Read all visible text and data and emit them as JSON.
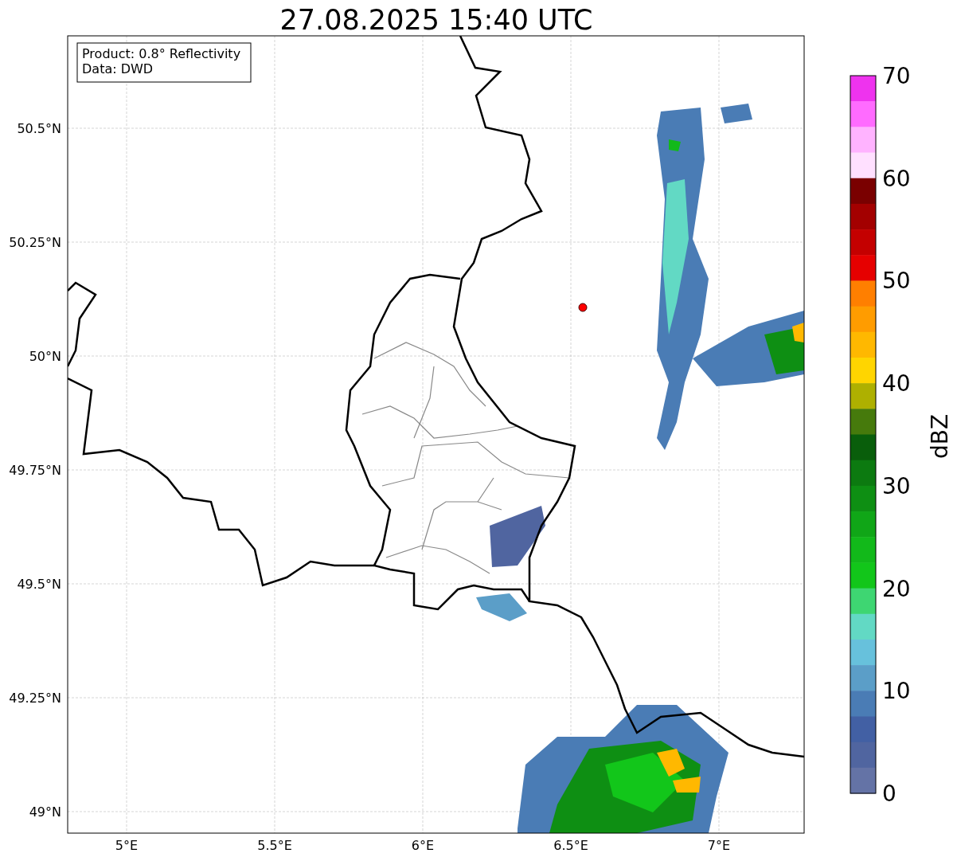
{
  "title": "27.08.2025 15:40 UTC",
  "info_box": [
    "Product: 0.8° Reflectivity",
    "Data: DWD"
  ],
  "y_ticks": [
    "50.5°N",
    "50.25°N",
    "50°N",
    "49.75°N",
    "49.5°N",
    "49.25°N",
    "49°N"
  ],
  "x_ticks": [
    "5°E",
    "5.5°E",
    "6°E",
    "6.5°E",
    "7°E"
  ],
  "colorbar": {
    "label": "dBZ",
    "ticks": [
      "70",
      "60",
      "50",
      "40",
      "30",
      "20",
      "10",
      "0"
    ],
    "segments": [
      {
        "color": "#ee33ee"
      },
      {
        "color": "#ff6bff"
      },
      {
        "color": "#ffb3ff"
      },
      {
        "color": "#ffe0ff"
      },
      {
        "color": "#7a0000"
      },
      {
        "color": "#a30000"
      },
      {
        "color": "#c40000"
      },
      {
        "color": "#e60000"
      },
      {
        "color": "#ff7f00"
      },
      {
        "color": "#ff9c00"
      },
      {
        "color": "#ffb800"
      },
      {
        "color": "#ffd500"
      },
      {
        "color": "#aeb000"
      },
      {
        "color": "#467a0c"
      },
      {
        "color": "#095e0b"
      },
      {
        "color": "#0c7a10"
      },
      {
        "color": "#0e8f13"
      },
      {
        "color": "#10a617"
      },
      {
        "color": "#12b91a"
      },
      {
        "color": "#12c61a"
      },
      {
        "color": "#3ed672"
      },
      {
        "color": "#62d9c4"
      },
      {
        "color": "#67c1dc"
      },
      {
        "color": "#5b9ec8"
      },
      {
        "color": "#4a7cb5"
      },
      {
        "color": "#4260a4"
      },
      {
        "color": "#5065a0"
      },
      {
        "color": "#6473a6"
      }
    ]
  }
}
